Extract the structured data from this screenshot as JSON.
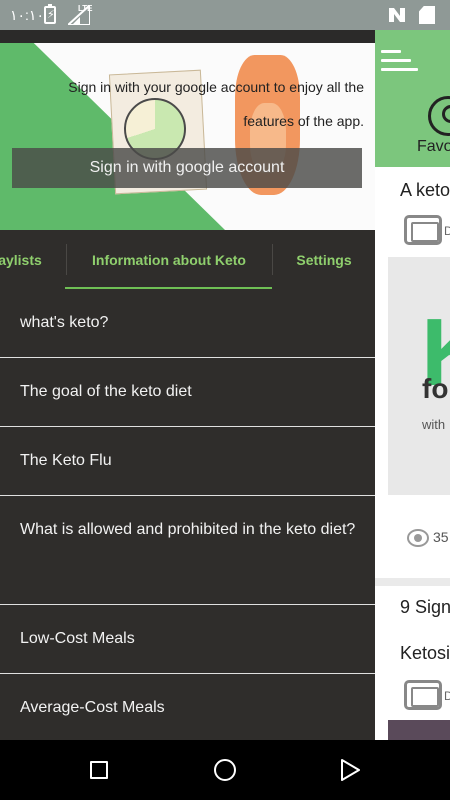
{
  "status_bar": {
    "time": "١٠:١٠",
    "network": "LTE"
  },
  "drawer": {
    "banner": {
      "sign_in_prompt": "Sign in with your google account to enjoy all the features of the app.",
      "sign_in_button": "Sign in with  google account"
    },
    "tabs": [
      {
        "label": "aylists"
      },
      {
        "label": "Information about Keto",
        "selected": true
      },
      {
        "label": "Settings"
      }
    ],
    "items": [
      {
        "label": "what's keto?"
      },
      {
        "label": "The goal of the keto diet"
      },
      {
        "label": "The Keto Flu"
      },
      {
        "label": "What is allowed and prohibited in the keto diet?"
      },
      {
        "label": "Low-Cost Meals"
      },
      {
        "label": "Average-Cost Meals"
      }
    ]
  },
  "main": {
    "favorites_label": "Favo",
    "cards": [
      {
        "title": "A keto",
        "channel_initial": "D",
        "thumb_big_letter": "K",
        "thumb_line2": "fo",
        "thumb_line3": "with",
        "views": "35"
      },
      {
        "title_line1": "9 Sign",
        "title_line2": "Ketosi",
        "channel_initial": "D"
      }
    ]
  },
  "colors": {
    "accent_green": "#7cc67d",
    "tab_text": "#8fcf6d",
    "drawer_bg": "#2f2d2b",
    "status_bar": "#8f9996"
  },
  "icons": {
    "status": [
      "battery-charging-icon",
      "signal-lte-icon",
      "n-notification-icon",
      "sd-card-icon"
    ],
    "nav": [
      "recents-square-icon",
      "home-circle-icon",
      "back-triangle-icon"
    ]
  }
}
